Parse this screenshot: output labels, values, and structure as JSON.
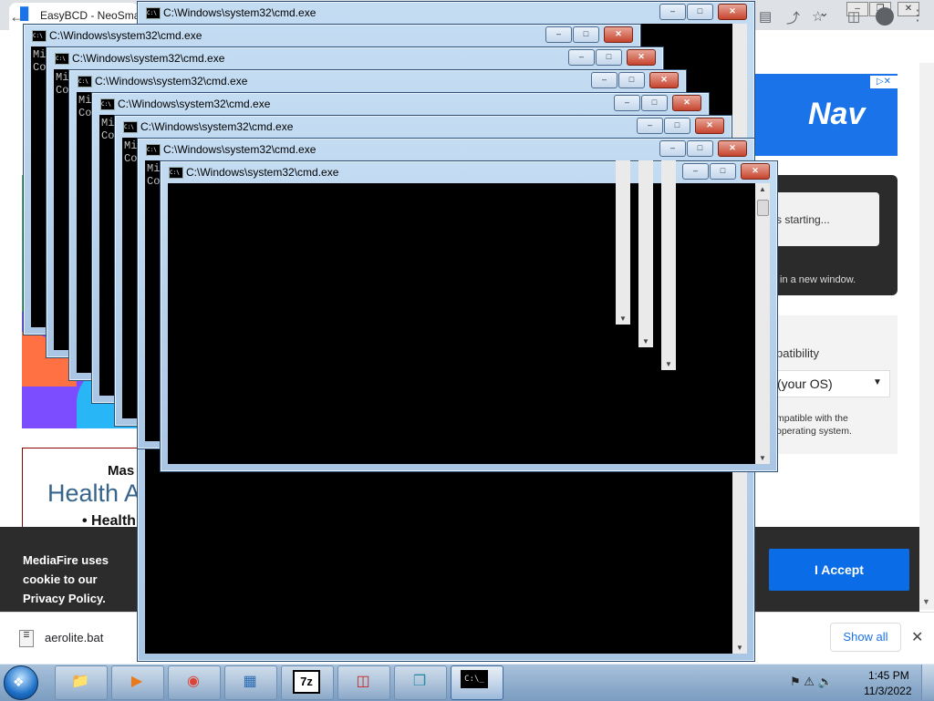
{
  "browser": {
    "tab_title": "EasyBCD - NeoSmar",
    "download_filename": "aerolite.bat",
    "show_all_label": "Show all"
  },
  "page": {
    "ad_nav_logo": "Nav",
    "starting_text": "s starting...",
    "new_window_text": "in a new window.",
    "compat_title": "patibility",
    "os_select_value": "(your OS)",
    "compat_note": "mpatible with the operating system.",
    "ad_line1": "Mas",
    "ad_line2": "Health A",
    "ad_line3": "• Health",
    "cookie_text": "MediaFire uses cookie to our Privacy Policy.",
    "accept_label": "I Accept"
  },
  "cmd": {
    "title": "C:\\Windows\\system32\\cmd.exe",
    "console_snippet": "Mi\nCo"
  },
  "taskbar": {
    "time": "1:45 PM",
    "date": "11/3/2022",
    "seven_zip_label": "7z"
  },
  "icons": {
    "close": "✕",
    "min": "–",
    "max": "□"
  }
}
